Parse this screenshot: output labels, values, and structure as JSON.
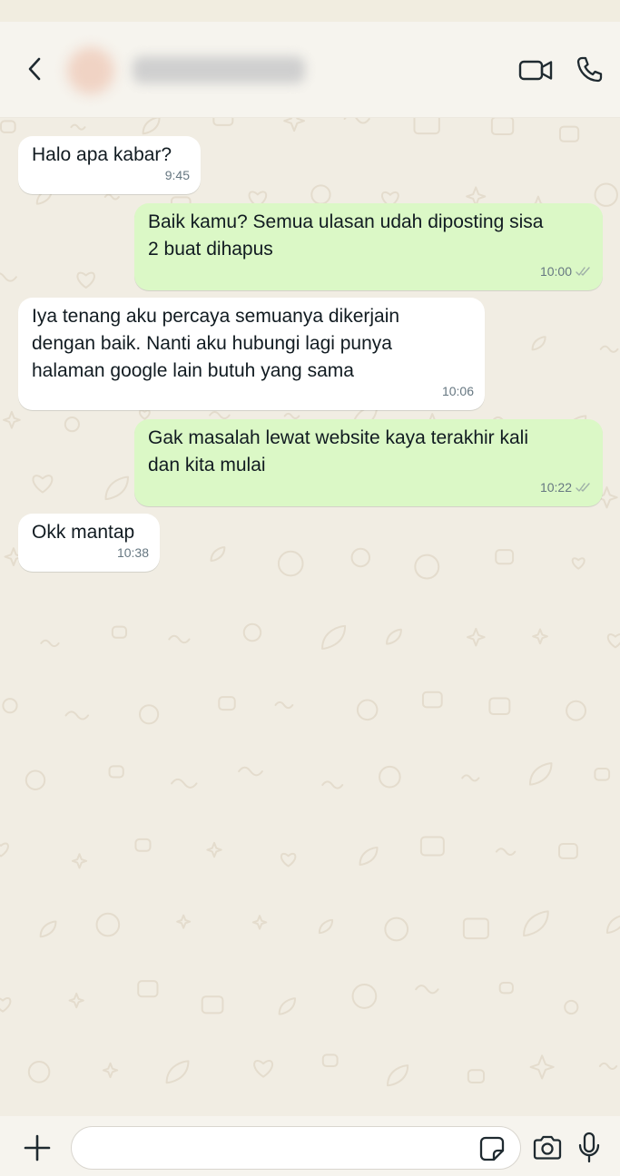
{
  "header": {
    "contact_name": "",
    "icons": {
      "back": "chevron-left-icon",
      "video": "video-camera-icon",
      "call": "phone-icon"
    }
  },
  "messages": [
    {
      "direction": "incoming",
      "text": "Halo apa kabar?",
      "time": "9:45"
    },
    {
      "direction": "outgoing",
      "text": "Baik kamu? Semua ulasan udah diposting sisa\n2 buat dihapus",
      "time": "10:00",
      "status": "read"
    },
    {
      "direction": "incoming",
      "text": "Iya tenang aku percaya semuanya dikerjain\ndengan baik. Nanti aku hubungi lagi punya\nhalaman google lain butuh yang sama",
      "time": "10:06"
    },
    {
      "direction": "outgoing",
      "text": "Gak masalah lewat website kaya terakhir kali\ndan kita mulai",
      "time": "10:22",
      "status": "read"
    },
    {
      "direction": "incoming",
      "text": "Okk mantap",
      "time": "10:38"
    }
  ],
  "composer": {
    "placeholder": "",
    "value": "",
    "icons": {
      "attach": "plus-icon",
      "sticker": "sticker-icon",
      "camera": "camera-icon",
      "mic": "microphone-icon"
    }
  },
  "colors": {
    "incoming_bubble": "#ffffff",
    "outgoing_bubble": "#dbf8c6",
    "chat_background": "#f1ede3",
    "timestamp": "#667781",
    "doodle": "#e4dccd"
  }
}
